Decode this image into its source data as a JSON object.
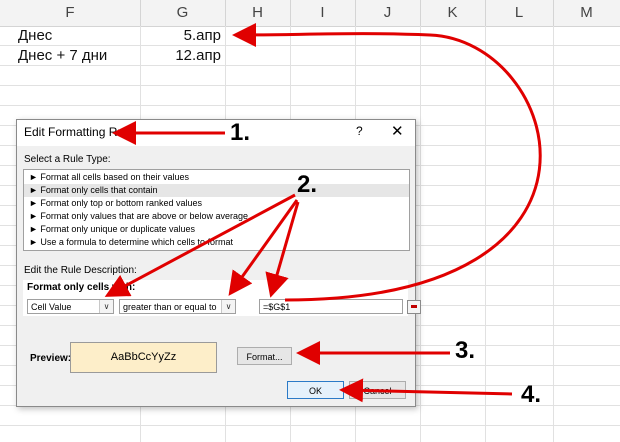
{
  "sheet": {
    "columns": [
      "F",
      "G",
      "H",
      "I",
      "J",
      "K",
      "L",
      "M"
    ],
    "rows": [
      {
        "label": "Днес",
        "value": "5.апр"
      },
      {
        "label": "Днес + 7 дни",
        "value": "12.апр"
      }
    ]
  },
  "dialog": {
    "title": "Edit Formatting Rule",
    "help_label": "?",
    "close_label": "✕",
    "select_rule_type_label": "Select a Rule Type:",
    "rule_types": [
      "► Format all cells based on their values",
      "► Format only cells that contain",
      "► Format only top or bottom ranked values",
      "► Format only values that are above or below average",
      "► Format only unique or duplicate values",
      "► Use a formula to determine which cells to format"
    ],
    "selected_rule_index": 1,
    "edit_description_label": "Edit the Rule Description:",
    "format_only_cells_with_label": "Format only cells with:",
    "condition_type": "Cell Value",
    "operator": "greater than or equal to",
    "formula_value": "=$G$1",
    "preview_label": "Preview:",
    "preview_sample": "AaBbCcYyZz",
    "format_button": "Format...",
    "ok_button": "OK",
    "cancel_button": "Cancel"
  },
  "annotations": [
    "1.",
    "2.",
    "3.",
    "4."
  ],
  "colors": {
    "arrow": "#e00000",
    "preview_fill": "#fdeec9",
    "selected_row": "#e6e6e6"
  }
}
